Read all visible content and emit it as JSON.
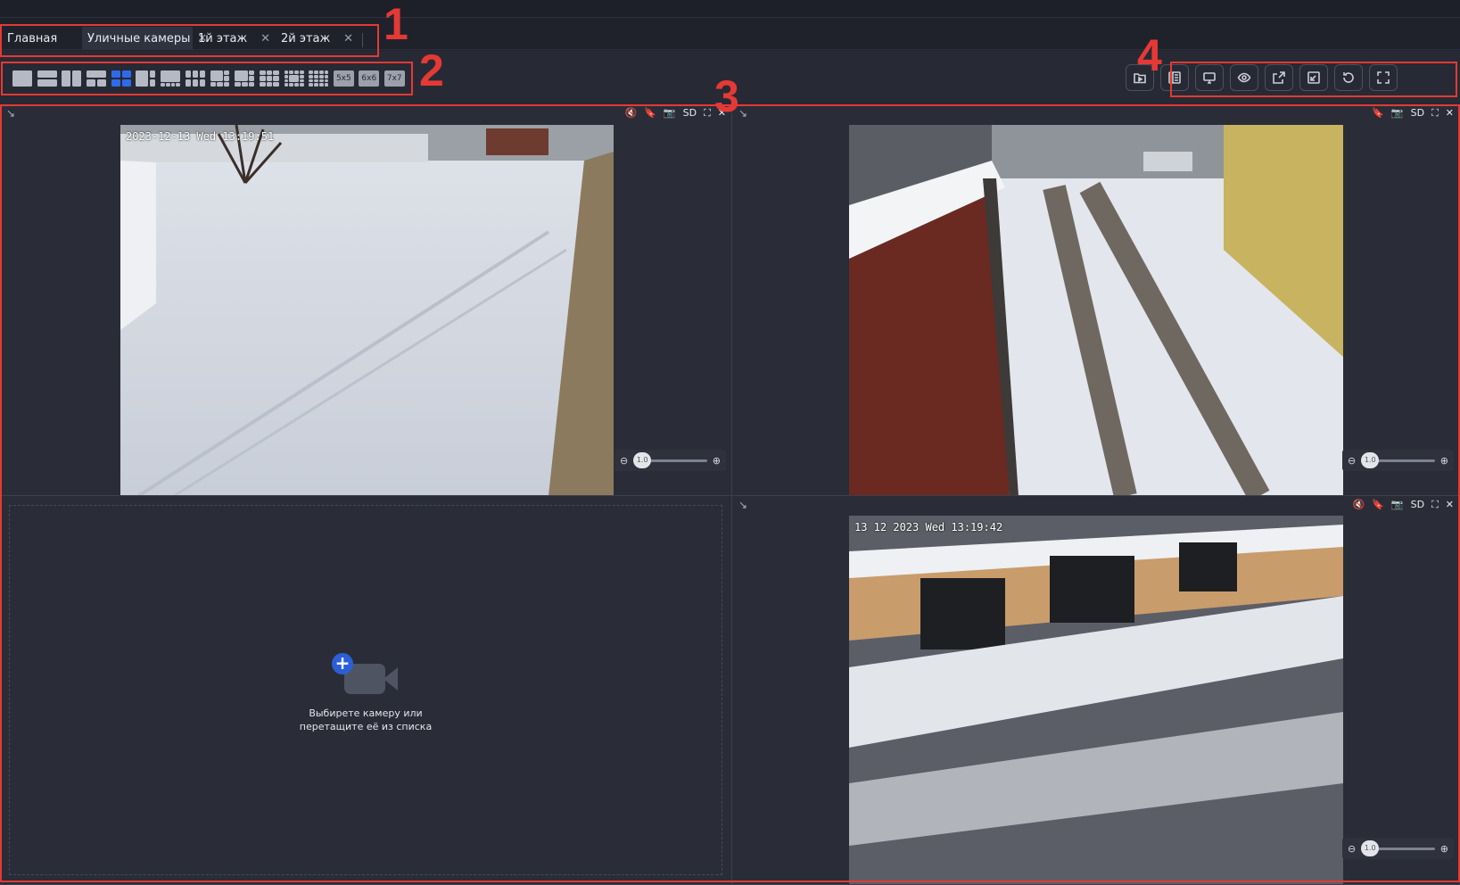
{
  "tabs": [
    {
      "label": "Главная",
      "closable": false,
      "active": false
    },
    {
      "label": "Уличные камеры",
      "closable": true,
      "active": true
    },
    {
      "label": "1й этаж",
      "closable": true,
      "active": false
    },
    {
      "label": "2й этаж",
      "closable": true,
      "active": false
    }
  ],
  "tab_close_glyph": "✕",
  "annotations": [
    "1",
    "2",
    "3",
    "4"
  ],
  "layout_toolbar": {
    "text_options": [
      "5x5",
      "6x6",
      "7x7"
    ],
    "selected_index": 4
  },
  "actions": [
    {
      "icon": "folder-play-icon"
    },
    {
      "icon": "list-panel-icon"
    },
    {
      "icon": "monitor-icon"
    },
    {
      "icon": "eye-icon"
    },
    {
      "icon": "export-icon"
    },
    {
      "icon": "exit-window-icon"
    },
    {
      "icon": "refresh-icon"
    },
    {
      "icon": "fullscreen-icon"
    }
  ],
  "cells": {
    "top_left": {
      "osd": "2023-12-13 Wed 13:19:51",
      "tools": {
        "mute": "🔇",
        "bookmark": "🔖",
        "snapshot": "📷",
        "quality": "SD",
        "fullscreen": "⛶",
        "close": "✕"
      },
      "zoom_value": "1.0"
    },
    "top_right": {
      "osd": "",
      "tools": {
        "bookmark": "🔖",
        "snapshot": "📷",
        "quality": "SD",
        "fullscreen": "⛶",
        "close": "✕"
      },
      "zoom_value": "1.0"
    },
    "bottom_left": {
      "empty_line1": "Выбирете камеру или",
      "empty_line2": "перетащите её из списка"
    },
    "bottom_right": {
      "osd": "13 12 2023 Wed 13:19:42",
      "tools": {
        "mute": "🔇",
        "bookmark": "🔖",
        "snapshot": "📷",
        "quality": "SD",
        "fullscreen": "⛶",
        "close": "✕"
      },
      "zoom_value": "1.0"
    }
  },
  "colors": {
    "accent": "#2f6be8",
    "annotation": "#e53935",
    "background": "#22252f"
  }
}
